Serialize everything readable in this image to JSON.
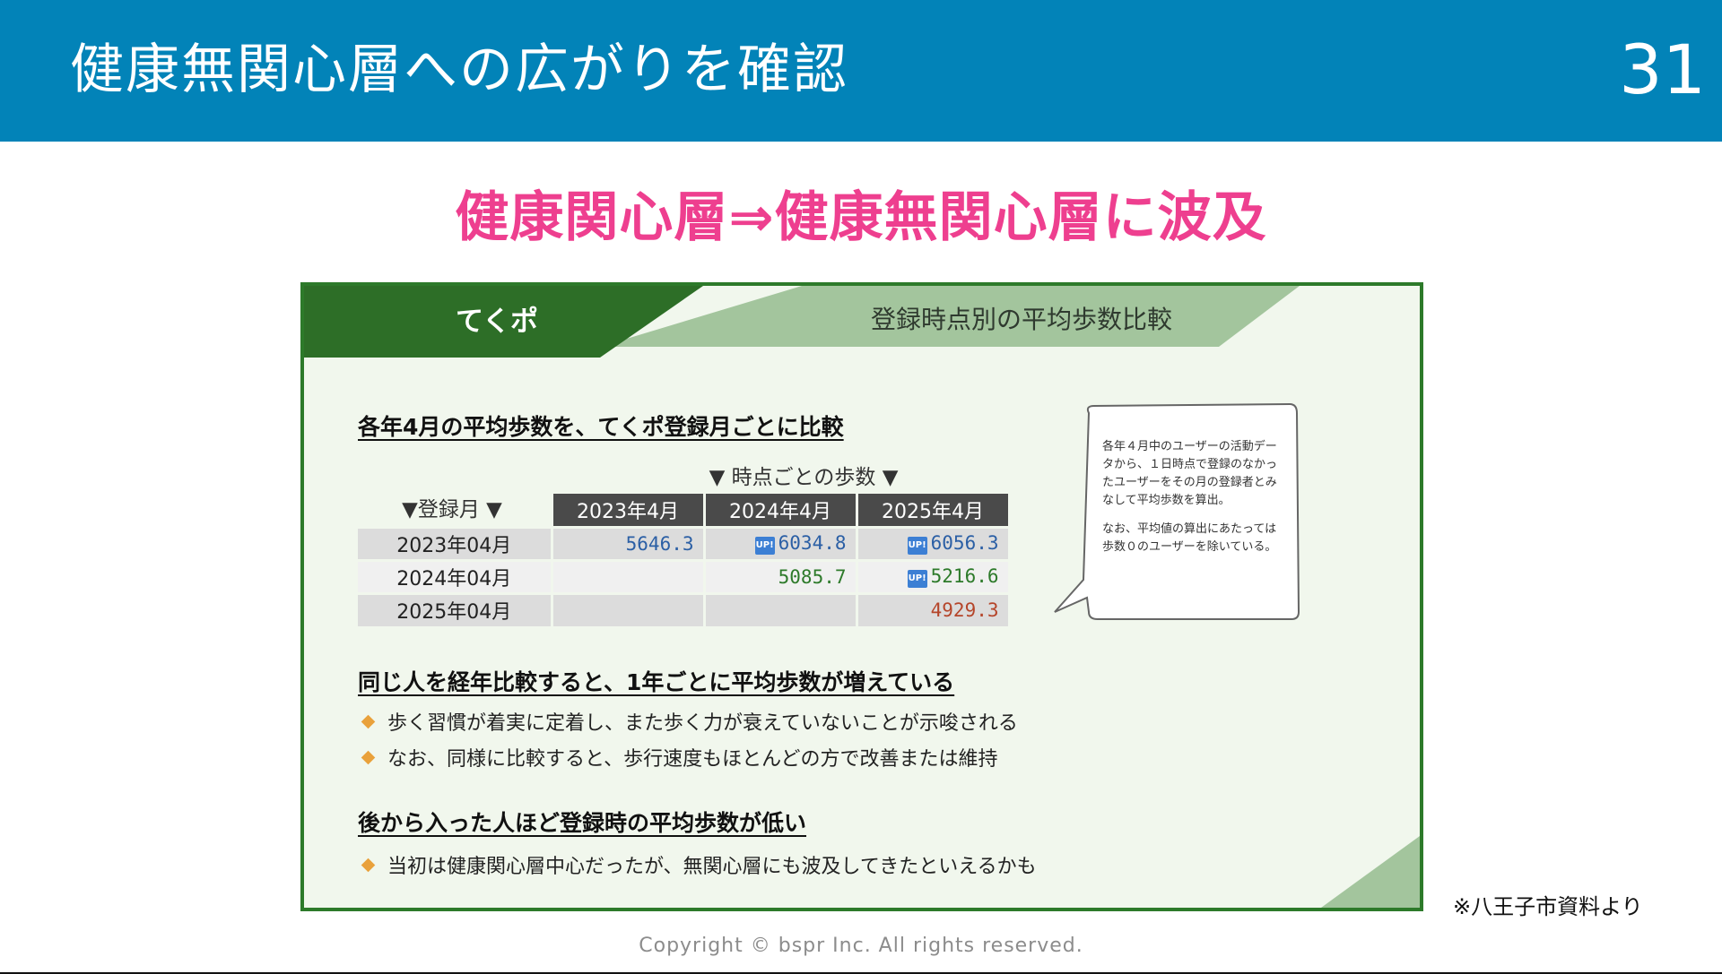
{
  "header": {
    "title": "健康無関心層への広がりを確認",
    "page_number": "31",
    "bg_color": "#0283b8"
  },
  "headline": "健康関心層⇒健康無関心層に波及",
  "panel": {
    "tab_label": "てくポ",
    "header_title": "登録時点別の平均歩数比較",
    "section1_heading": "各年4月の平均歩数を、てくポ登録月ごとに比較",
    "table": {
      "caption": "▼ 時点ごとの歩数 ▼",
      "row_caption": "▼登録月 ▼",
      "columns": [
        "2023年4月",
        "2024年4月",
        "2025年4月"
      ],
      "rows": [
        {
          "label": "2023年04月",
          "values": [
            {
              "text": "5646.3",
              "up": false,
              "color": "blue"
            },
            {
              "text": "6034.8",
              "up": true,
              "color": "blue"
            },
            {
              "text": "6056.3",
              "up": true,
              "color": "blue"
            }
          ]
        },
        {
          "label": "2024年04月",
          "values": [
            {
              "text": "",
              "up": false,
              "color": ""
            },
            {
              "text": "5085.7",
              "up": false,
              "color": "green"
            },
            {
              "text": "5216.6",
              "up": true,
              "color": "green"
            }
          ]
        },
        {
          "label": "2025年04月",
          "values": [
            {
              "text": "",
              "up": false,
              "color": ""
            },
            {
              "text": "",
              "up": false,
              "color": ""
            },
            {
              "text": "4929.3",
              "up": false,
              "color": "red"
            }
          ]
        }
      ],
      "up_badge": "UP!"
    },
    "note": {
      "p1": "各年４月中のユーザーの活動データから、１日時点で登録のなかったユーザーをその月の登録者とみなして平均歩数を算出。",
      "p2": "なお、平均値の算出にあたっては歩数０のユーザーを除いている。"
    },
    "section2_heading": "同じ人を経年比較すると、1年ごとに平均歩数が増えている",
    "section2_bullets": [
      "歩く習慣が着実に定着し、また歩く力が衰えていないことが示唆される",
      "なお、同様に比較すると、歩行速度もほとんどの方で改善または維持"
    ],
    "section3_heading": "後から入った人ほど登録時の平均歩数が低い",
    "section3_bullets": [
      "当初は健康関心層中心だったが、無関心層にも波及してきたといえるかも"
    ]
  },
  "source_note": "※八王子市資料より",
  "copyright": "Copyright © bspr Inc. All rights reserved.",
  "colors": {
    "accent_pink": "#ee3f8f",
    "panel_green": "#2d7a2a",
    "bullet_orange": "#e9a13b"
  }
}
